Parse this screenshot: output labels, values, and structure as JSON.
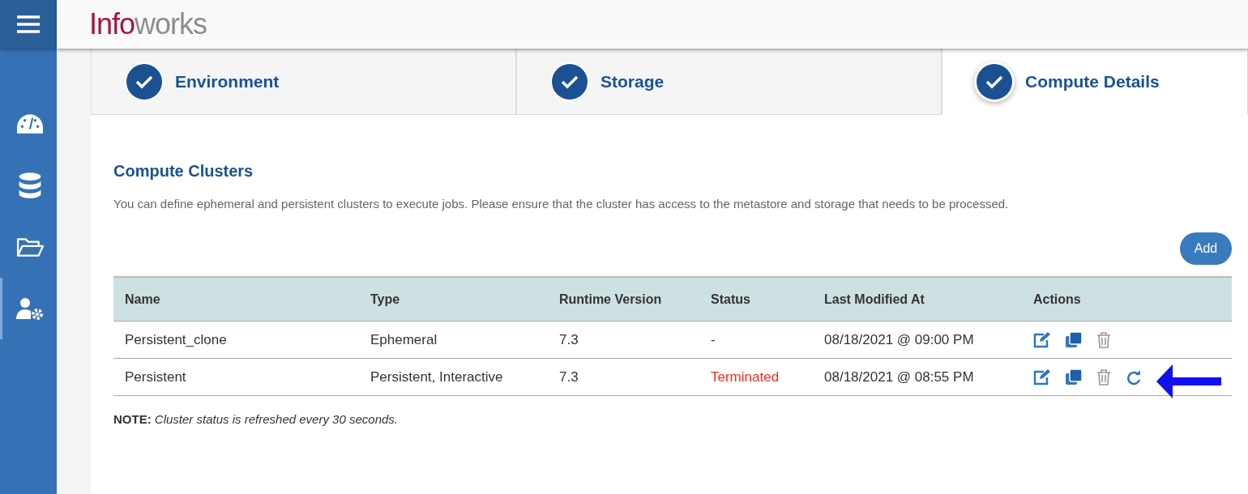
{
  "header": {
    "logo_part1": "Info",
    "logo_part2": "works"
  },
  "sidebar": {
    "items": [
      {
        "kind": "gauge",
        "selected": false
      },
      {
        "kind": "database",
        "selected": false
      },
      {
        "kind": "folder",
        "selected": false
      },
      {
        "kind": "users",
        "selected": true
      }
    ]
  },
  "steps": [
    {
      "label": "Environment",
      "selected": false
    },
    {
      "label": "Storage",
      "selected": false
    },
    {
      "label": "Compute Details",
      "selected": true
    }
  ],
  "section": {
    "title": "Compute Clusters",
    "description": "You can define ephemeral and persistent clusters to execute jobs. Please ensure that the cluster has access to the metastore and storage that needs to be processed.",
    "add_button": "Add"
  },
  "table": {
    "columns": [
      "Name",
      "Type",
      "Runtime Version",
      "Status",
      "Last Modified At",
      "Actions"
    ],
    "rows": [
      {
        "name": "Persistent_clone",
        "type": "Ephemeral",
        "runtime": "7.3",
        "status": "-",
        "color": "#333333",
        "modified": "08/18/2021 @ 09:00 PM",
        "actions": [
          {
            "kind": "edit"
          },
          {
            "kind": "clone"
          },
          {
            "kind": "delete"
          }
        ],
        "annotated": false
      },
      {
        "name": "Persistent",
        "type": "Persistent, Interactive",
        "runtime": "7.3",
        "status": "Terminated",
        "color": "#ff2a1a",
        "modified": "08/18/2021 @ 08:55 PM",
        "actions": [
          {
            "kind": "edit"
          },
          {
            "kind": "clone"
          },
          {
            "kind": "delete"
          },
          {
            "kind": "restart"
          }
        ],
        "annotated": true
      }
    ]
  },
  "note": {
    "label": "NOTE:",
    "text": "Cluster status is refreshed every 30 seconds."
  }
}
